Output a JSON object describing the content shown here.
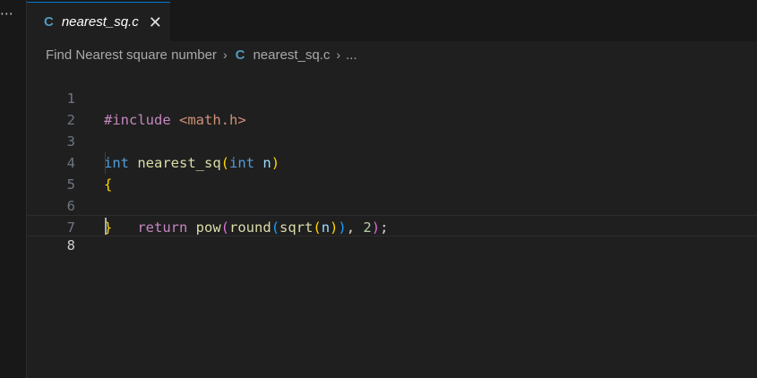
{
  "sidebar": {
    "more_label": "⋯"
  },
  "tabs": [
    {
      "icon": "c-language-icon",
      "icon_text": "C",
      "label": "nearest_sq.c",
      "close_glyph": "✕"
    }
  ],
  "breadcrumb": {
    "folder": "Find Nearest square number",
    "separator": "›",
    "file_icon_text": "C",
    "file": "nearest_sq.c",
    "ellipsis": "..."
  },
  "editor": {
    "current_line": 8,
    "lines": [
      {
        "n": "1",
        "tokens": {
          "a": "#include",
          "b": " ",
          "c": "<math.h>"
        }
      },
      {
        "n": "2"
      },
      {
        "n": "3",
        "tokens": {
          "a": "int",
          "b": " ",
          "c": "nearest_sq",
          "d": "(",
          "e": "int",
          "f": " ",
          "g": "n",
          "h": ")"
        }
      },
      {
        "n": "4",
        "tokens": {
          "a": "{"
        }
      },
      {
        "n": "5",
        "tokens": {
          "a": "    ",
          "b": "return",
          "c": " ",
          "d": "pow",
          "e": "(",
          "f": "round",
          "g": "(",
          "h": "sqrt",
          "i": "(",
          "j": "n",
          "k": ")",
          "l": ")",
          "m": ",",
          "n": " ",
          "o": "2",
          "p": ")",
          "q": ";"
        }
      },
      {
        "n": "6",
        "tokens": {
          "a": "}"
        }
      },
      {
        "n": "7"
      },
      {
        "n": "8"
      }
    ]
  },
  "colors": {
    "editor_bg": "#1f1f1f",
    "tab_accent": "#0078d4",
    "c_icon": "#519aba"
  }
}
